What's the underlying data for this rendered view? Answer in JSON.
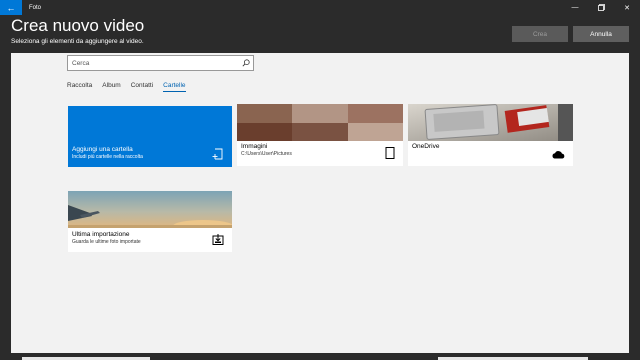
{
  "app": {
    "title": "Foto"
  },
  "header": {
    "title": "Crea nuovo video",
    "subtitle": "Seleziona gli elementi da aggiungere al video.",
    "create_label": "Crea",
    "cancel_label": "Annulla"
  },
  "search": {
    "placeholder": "Cerca",
    "value": ""
  },
  "tabs": [
    {
      "label": "Raccolta"
    },
    {
      "label": "Album"
    },
    {
      "label": "Contatti"
    },
    {
      "label": "Cartelle",
      "active": true
    }
  ],
  "tiles": {
    "add_folder": {
      "name": "Aggiungi una cartella",
      "sub": "Includi più cartelle nella raccolta"
    },
    "images": {
      "name": "Immagini",
      "sub": "C:\\Users\\User\\Pictures"
    },
    "onedrive": {
      "name": "OneDrive"
    },
    "last_import": {
      "name": "Ultima importazione",
      "sub": "Guarda le ultime foto importate"
    }
  },
  "colors": {
    "accent": "#0078d7",
    "tab_active": "#0063b1",
    "panel": "#f2f2f2",
    "chrome": "#2b2b2b"
  },
  "icons": {
    "back": "arrow-left-icon",
    "search": "search-icon",
    "add_folder": "add-folder-icon",
    "images": "tablet-icon",
    "onedrive": "cloud-icon",
    "import": "import-icon"
  }
}
